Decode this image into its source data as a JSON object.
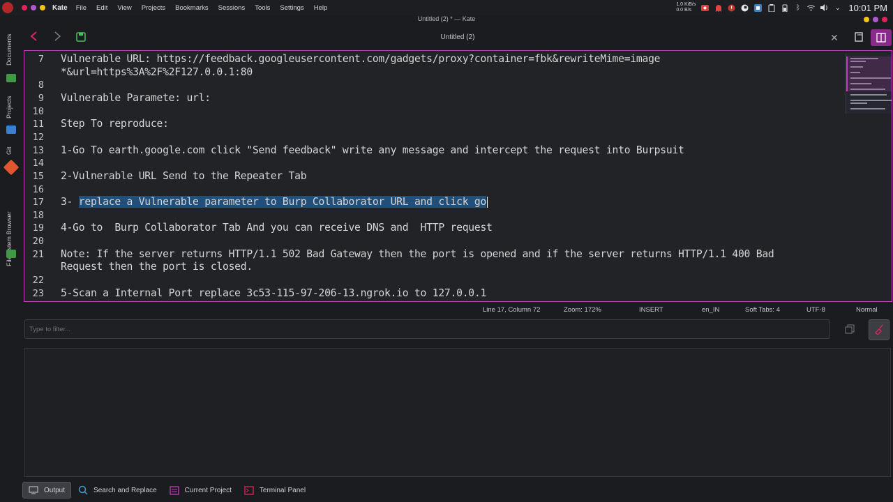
{
  "topbar": {
    "app_name": "Kate",
    "menus": [
      "File",
      "Edit",
      "View",
      "Projects",
      "Bookmarks",
      "Sessions",
      "Tools",
      "Settings",
      "Help"
    ],
    "net_up": "1.0 KiB/s",
    "net_down": "0.0 B/s",
    "clock": "10:01 PM"
  },
  "window": {
    "title": "Untitled (2) * — Kate"
  },
  "sidebar": {
    "tabs": [
      "Documents",
      "Projects",
      "Git",
      "Filesystem Browser"
    ]
  },
  "toolbar": {
    "doc_title": "Untitled (2)"
  },
  "editor": {
    "lines": [
      {
        "n": "7",
        "text": "Vulnerable URL: https://feedback.googleusercontent.com/gadgets/proxy?container=fbk&rewriteMime=image"
      },
      {
        "n": "",
        "text": "*&url=https%3A%2F%2F127.0.0.1:80"
      },
      {
        "n": "8",
        "text": ""
      },
      {
        "n": "9",
        "text": "Vulnerable Paramete: url:"
      },
      {
        "n": "10",
        "text": ""
      },
      {
        "n": "11",
        "text": "Step To reproduce:"
      },
      {
        "n": "12",
        "text": ""
      },
      {
        "n": "13",
        "text": "1-Go To earth.google.com click \"Send feedback\" write any message and intercept the request into Burpsuit"
      },
      {
        "n": "14",
        "text": ""
      },
      {
        "n": "15",
        "text": "2-Vulnerable URL Send to the Repeater Tab"
      },
      {
        "n": "16",
        "text": ""
      },
      {
        "n": "17",
        "text": "3- ",
        "selected": "replace a Vulnerable parameter to Burp Collaborator URL and click go"
      },
      {
        "n": "18",
        "text": ""
      },
      {
        "n": "19",
        "text": "4-Go to  Burp Collaborator Tab And you can receive DNS and  HTTP request"
      },
      {
        "n": "20",
        "text": ""
      },
      {
        "n": "21",
        "text": "Note: If the server returns HTTP/1.1 502 Bad Gateway then the port is opened and if the server returns HTTP/1.1 400 Bad"
      },
      {
        "n": "",
        "text": "Request then the port is closed."
      },
      {
        "n": "22",
        "text": ""
      },
      {
        "n": "23",
        "text": "5-Scan a Internal Port replace 3c53-115-97-206-13.ngrok.io to 127.0.0.1"
      }
    ]
  },
  "status": {
    "position": "Line 17, Column 72",
    "zoom": "Zoom: 172%",
    "mode": "INSERT",
    "language": "en_IN",
    "indent": "Soft Tabs: 4",
    "encoding": "UTF-8",
    "highlight": "Normal"
  },
  "output": {
    "filter_placeholder": "Type to filter..."
  },
  "bottom_tabs": [
    {
      "label": "Output",
      "icon": "output-icon"
    },
    {
      "label": "Search and Replace",
      "icon": "search-icon"
    },
    {
      "label": "Current Project",
      "icon": "project-icon"
    },
    {
      "label": "Terminal Panel",
      "icon": "terminal-icon"
    }
  ],
  "colors": {
    "accent": "#c23db8",
    "selection": "#1f4f7a",
    "background": "#1b1c20"
  }
}
